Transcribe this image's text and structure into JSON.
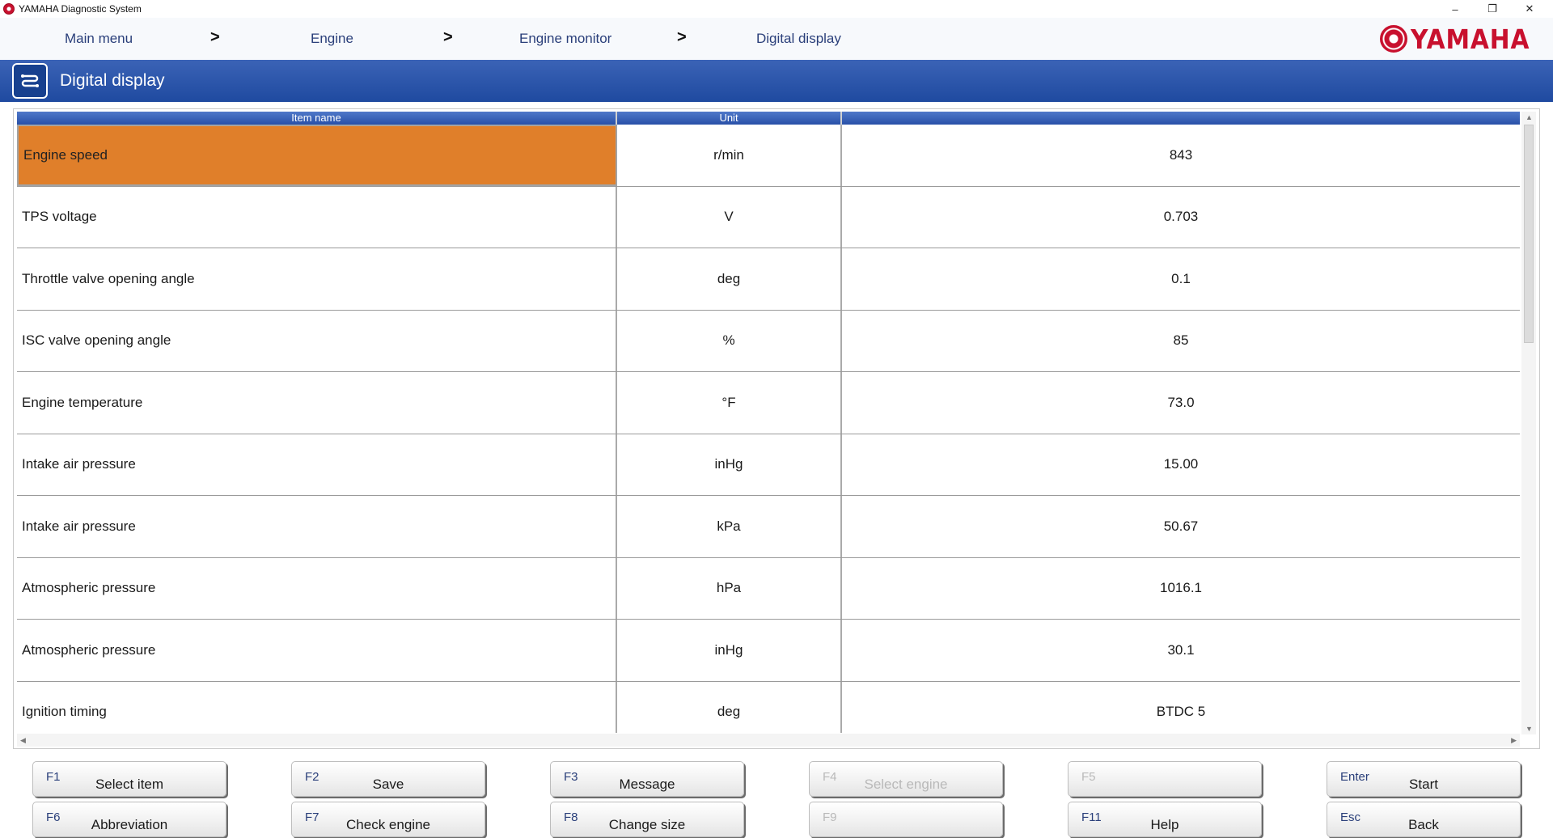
{
  "window": {
    "title": "YAMAHA Diagnostic System",
    "minimize": "–",
    "restore": "❐",
    "close": "✕"
  },
  "breadcrumb": {
    "items": [
      "Main menu",
      "Engine",
      "Engine monitor",
      "Digital display"
    ],
    "separator": ">"
  },
  "logo": {
    "text": "YAMAHA",
    "color": "#c8102e"
  },
  "header": {
    "title": "Digital display",
    "icon": "monitor-icon"
  },
  "table": {
    "columns": [
      "Item name",
      "Unit",
      ""
    ],
    "rows": [
      {
        "name": "Engine speed",
        "unit": "r/min",
        "value": "843"
      },
      {
        "name": "TPS voltage",
        "unit": "V",
        "value": "0.703"
      },
      {
        "name": "Throttle valve opening angle",
        "unit": "deg",
        "value": "0.1"
      },
      {
        "name": "ISC valve opening angle",
        "unit": "%",
        "value": "85"
      },
      {
        "name": "Engine temperature",
        "unit": "°F",
        "value": "73.0"
      },
      {
        "name": "Intake air pressure",
        "unit": "inHg",
        "value": "15.00"
      },
      {
        "name": "Intake air pressure",
        "unit": "kPa",
        "value": "50.67"
      },
      {
        "name": "Atmospheric pressure",
        "unit": "hPa",
        "value": "1016.1"
      },
      {
        "name": "Atmospheric pressure",
        "unit": "inHg",
        "value": "30.1"
      },
      {
        "name": "Ignition timing",
        "unit": "deg",
        "value": "BTDC 5"
      }
    ],
    "selected_row": 0,
    "selected_color": "#e07f2a"
  },
  "function_keys": [
    {
      "key": "F1",
      "label": "Select item",
      "enabled": true
    },
    {
      "key": "F2",
      "label": "Save",
      "enabled": true
    },
    {
      "key": "F3",
      "label": "Message",
      "enabled": true
    },
    {
      "key": "F4",
      "label": "Select engine",
      "enabled": false
    },
    {
      "key": "F5",
      "label": "",
      "enabled": false
    },
    {
      "key": "Enter",
      "label": "Start",
      "enabled": true
    },
    {
      "key": "F6",
      "label": "Abbreviation",
      "enabled": true
    },
    {
      "key": "F7",
      "label": "Check engine",
      "enabled": true
    },
    {
      "key": "F8",
      "label": "Change size",
      "enabled": true
    },
    {
      "key": "F9",
      "label": "",
      "enabled": false
    },
    {
      "key": "F11",
      "label": "Help",
      "enabled": true
    },
    {
      "key": "Esc",
      "label": "Back",
      "enabled": true
    }
  ],
  "colors": {
    "header_blue": "#2850a8",
    "crumb_text": "#2a3f7a"
  }
}
